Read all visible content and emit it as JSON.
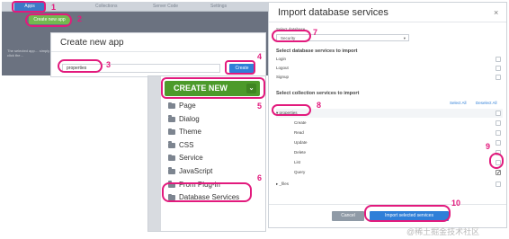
{
  "app": {
    "tabs": [
      "Apps",
      "Collections",
      "Server Code",
      "Settings"
    ],
    "create_new_app_button": "Create new app",
    "faded_text": "The selected app… simply click the…"
  },
  "create_dialog": {
    "title": "Create new app",
    "name_value": "properties",
    "create_button": "Create"
  },
  "dropdown": {
    "create_new_label": "CREATE NEW",
    "items": [
      "Page",
      "Dialog",
      "Theme",
      "CSS",
      "Service",
      "JavaScript",
      "From Plug-in",
      "Database Services"
    ]
  },
  "import_dialog": {
    "title": "Import database services",
    "close_glyph": "×",
    "select_db_label": "Select database",
    "db_selected": "Security",
    "section_db_services": "Select database services to import",
    "db_services": [
      "Login",
      "Logout",
      "Signup"
    ],
    "section_collection_services": "Select collection services to import",
    "select_all": "Select All",
    "deselect_all": "Deselect All",
    "collections": [
      {
        "name": "properties",
        "services": [
          {
            "name": "Create",
            "checked": false
          },
          {
            "name": "Read",
            "checked": false
          },
          {
            "name": "Update",
            "checked": false
          },
          {
            "name": "Delete",
            "checked": false
          },
          {
            "name": "List",
            "checked": false
          },
          {
            "name": "Query",
            "checked": true
          }
        ]
      },
      {
        "name": "_files",
        "services": []
      }
    ],
    "cancel_button": "Cancel",
    "import_button": "Import selected services"
  },
  "steps": [
    "1",
    "2",
    "3",
    "4",
    "5",
    "6",
    "7",
    "8",
    "9",
    "10"
  ],
  "watermark": "@稀土掘金技术社区",
  "colors": {
    "annotation": "#e21a7d",
    "primary_blue": "#2f7fd8",
    "create_green": "#4c9a2a"
  }
}
